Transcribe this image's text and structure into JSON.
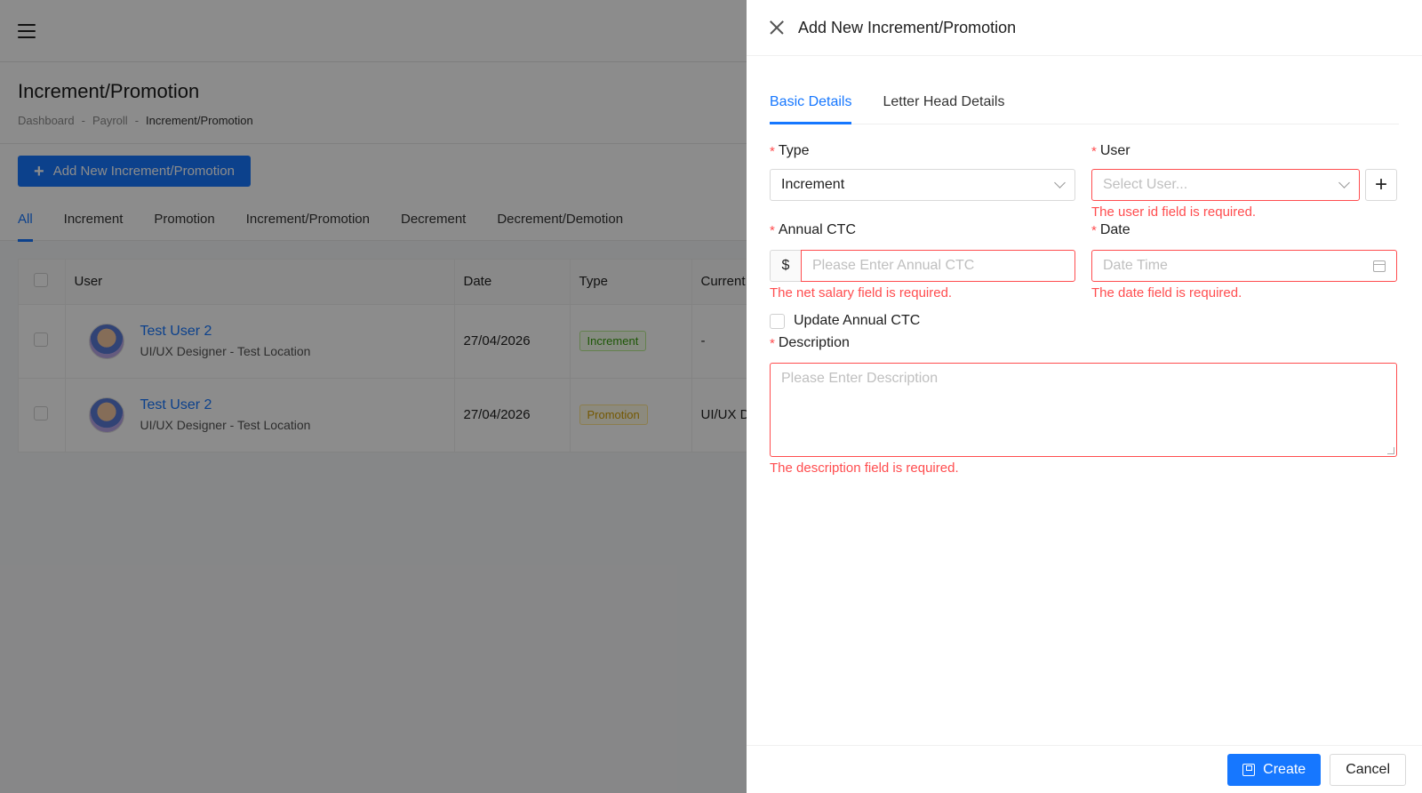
{
  "page": {
    "title": "Increment/Promotion",
    "breadcrumb": [
      "Dashboard",
      "-",
      "Payroll",
      "-",
      "Increment/Promotion"
    ],
    "add_button": "Add New Increment/Promotion",
    "tabs": [
      "All",
      "Increment",
      "Promotion",
      "Increment/Promotion",
      "Decrement",
      "Decrement/Demotion"
    ],
    "table": {
      "columns": [
        "User",
        "Date",
        "Type",
        "Current"
      ],
      "rows": [
        {
          "name": "Test User 2",
          "sub": "UI/UX Designer - Test Location",
          "date": "27/04/2026",
          "type": "Increment",
          "current": "-"
        },
        {
          "name": "Test User 2",
          "sub": "UI/UX Designer - Test Location",
          "date": "27/04/2026",
          "type": "Promotion",
          "current": "UI/UX D"
        }
      ]
    }
  },
  "drawer": {
    "title": "Add New Increment/Promotion",
    "tabs": [
      "Basic Details",
      "Letter Head Details"
    ],
    "form": {
      "type": {
        "label": "Type",
        "value": "Increment"
      },
      "user": {
        "label": "User",
        "placeholder": "Select User...",
        "error": "The user id field is required."
      },
      "annual_ctc": {
        "label": "Annual CTC",
        "currency": "$",
        "placeholder": "Please Enter Annual CTC",
        "error": "The net salary field is required."
      },
      "date": {
        "label": "Date",
        "placeholder": "Date Time",
        "error": "The date field is required."
      },
      "update_ctc": {
        "label": "Update Annual CTC"
      },
      "description": {
        "label": "Description",
        "placeholder": "Please Enter Description",
        "error": "The description field is required."
      },
      "required_mark": "*",
      "add_symbol": "+"
    },
    "footer": {
      "create": "Create",
      "cancel": "Cancel"
    }
  },
  "colors": {
    "primary": "#1677ff",
    "error": "#ff4d4f"
  }
}
